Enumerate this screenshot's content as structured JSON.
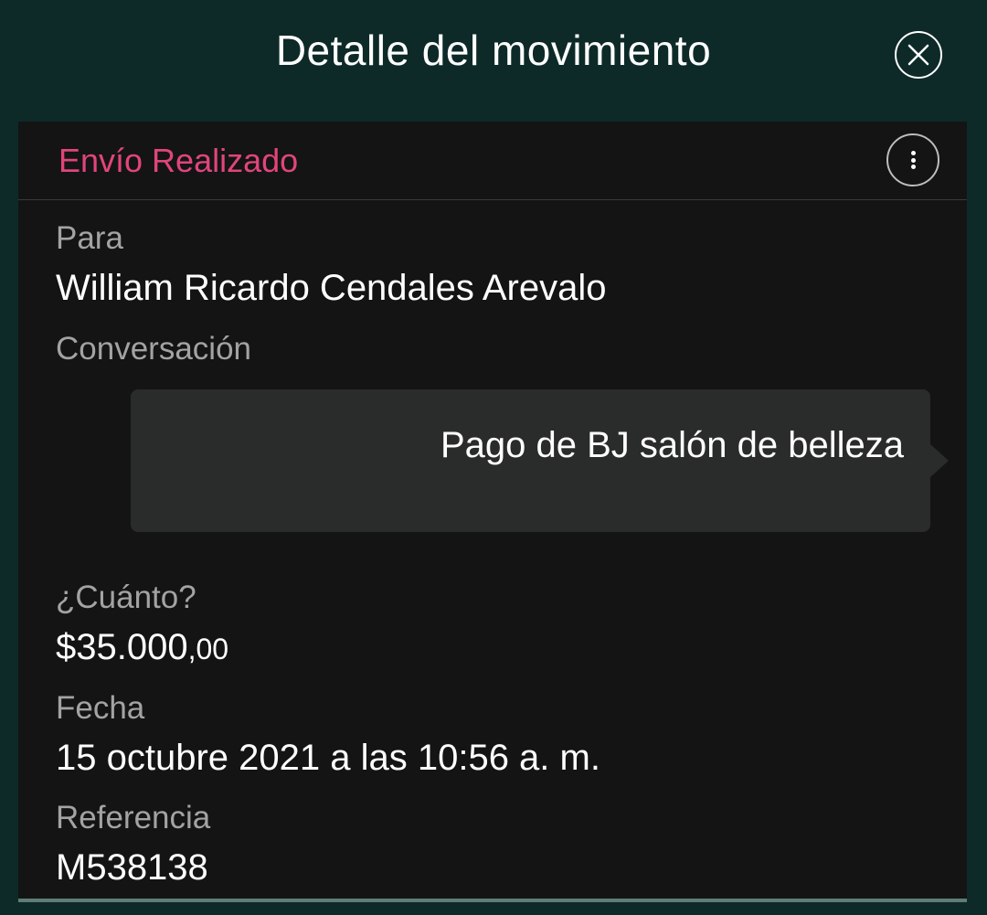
{
  "header": {
    "title": "Detalle del movimiento",
    "close_icon": "close-circle-icon"
  },
  "card": {
    "status": "Envío Realizado",
    "status_color": "#e0457b",
    "more_icon": "more-vertical-icon",
    "to_label": "Para",
    "to_value": "William Ricardo Cendales Arevalo",
    "conversation_label": "Conversación",
    "message": "Pago de BJ salón de belleza",
    "amount_label": "¿Cuánto?",
    "amount_main": "$35.000",
    "amount_cents": ",00",
    "date_label": "Fecha",
    "date_value": "15 octubre 2021 a las 10:56 a. m.",
    "reference_label": "Referencia",
    "reference_value": "M538138"
  },
  "colors": {
    "background": "#0d2a28",
    "card": "#141414",
    "bubble": "#2a2b2b"
  }
}
